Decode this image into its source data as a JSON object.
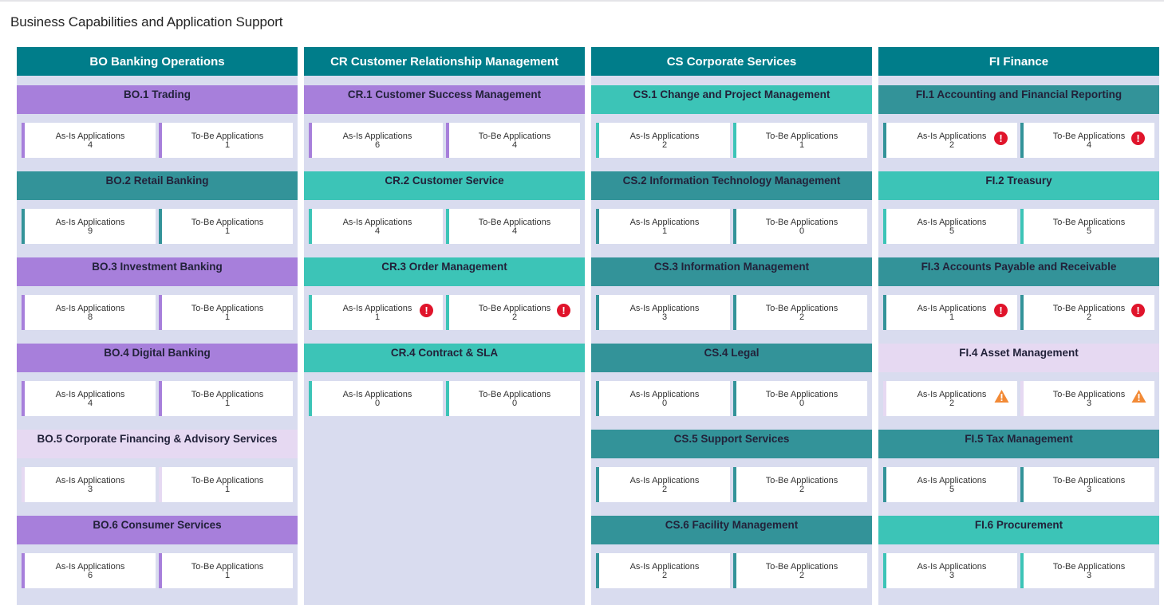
{
  "page_title": "Business Capabilities and Application Support",
  "colors": {
    "header": "#007d8a",
    "purple": "#a77fdb",
    "teal_dark": "#339399",
    "teal_light": "#3cc4b7",
    "lavender": "#e6d9f2",
    "column_bg": "#d9dcef",
    "error": "#e0142b",
    "warning": "#f28a36"
  },
  "columns": [
    {
      "title": "BO Banking Operations",
      "capabilities": [
        {
          "title": "BO.1 Trading",
          "color": "purple",
          "as_is_label": "As-Is Applications",
          "as_is": "4",
          "to_be_label": "To-Be Applications",
          "to_be": "1",
          "as_is_flag": "",
          "to_be_flag": ""
        },
        {
          "title": "BO.2 Retail Banking",
          "color": "teal_dark",
          "as_is_label": "As-Is Applications",
          "as_is": "9",
          "to_be_label": "To-Be Applications",
          "to_be": "1",
          "as_is_flag": "",
          "to_be_flag": ""
        },
        {
          "title": "BO.3 Investment Banking",
          "color": "purple",
          "as_is_label": "As-Is Applications",
          "as_is": "8",
          "to_be_label": "To-Be Applications",
          "to_be": "1",
          "as_is_flag": "",
          "to_be_flag": ""
        },
        {
          "title": "BO.4 Digital Banking",
          "color": "purple",
          "as_is_label": "As-Is Applications",
          "as_is": "4",
          "to_be_label": "To-Be Applications",
          "to_be": "1",
          "as_is_flag": "",
          "to_be_flag": ""
        },
        {
          "title": "BO.5 Corporate Financing & Advisory Services",
          "color": "lavender",
          "as_is_label": "As-Is Applications",
          "as_is": "3",
          "to_be_label": "To-Be Applications",
          "to_be": "1",
          "as_is_flag": "",
          "to_be_flag": ""
        },
        {
          "title": "BO.6 Consumer Services",
          "color": "purple",
          "as_is_label": "As-Is Applications",
          "as_is": "6",
          "to_be_label": "To-Be Applications",
          "to_be": "1",
          "as_is_flag": "",
          "to_be_flag": ""
        }
      ]
    },
    {
      "title": "CR Customer Relationship Management",
      "capabilities": [
        {
          "title": "CR.1 Customer Success Management",
          "color": "purple",
          "as_is_label": "As-Is Applications",
          "as_is": "6",
          "to_be_label": "To-Be Applications",
          "to_be": "4",
          "as_is_flag": "",
          "to_be_flag": ""
        },
        {
          "title": "CR.2 Customer Service",
          "color": "teal_light",
          "as_is_label": "As-Is Applications",
          "as_is": "4",
          "to_be_label": "To-Be Applications",
          "to_be": "4",
          "as_is_flag": "",
          "to_be_flag": ""
        },
        {
          "title": "CR.3 Order Management",
          "color": "teal_light",
          "as_is_label": "As-Is Applications",
          "as_is": "1",
          "to_be_label": "To-Be Applications",
          "to_be": "2",
          "as_is_flag": "error",
          "to_be_flag": "error"
        },
        {
          "title": "CR.4 Contract & SLA",
          "color": "teal_light",
          "as_is_label": "As-Is Applications",
          "as_is": "0",
          "to_be_label": "To-Be Applications",
          "to_be": "0",
          "as_is_flag": "",
          "to_be_flag": ""
        }
      ]
    },
    {
      "title": "CS Corporate Services",
      "capabilities": [
        {
          "title": "CS.1 Change and Project Management",
          "color": "teal_light",
          "as_is_label": "As-Is Applications",
          "as_is": "2",
          "to_be_label": "To-Be Applications",
          "to_be": "1",
          "as_is_flag": "",
          "to_be_flag": ""
        },
        {
          "title": "CS.2 Information Technology Management",
          "color": "teal_dark",
          "as_is_label": "As-Is Applications",
          "as_is": "1",
          "to_be_label": "To-Be Applications",
          "to_be": "0",
          "as_is_flag": "",
          "to_be_flag": ""
        },
        {
          "title": "CS.3 Information Management",
          "color": "teal_dark",
          "as_is_label": "As-Is Applications",
          "as_is": "3",
          "to_be_label": "To-Be Applications",
          "to_be": "2",
          "as_is_flag": "",
          "to_be_flag": ""
        },
        {
          "title": "CS.4 Legal",
          "color": "teal_dark",
          "as_is_label": "As-Is Applications",
          "as_is": "0",
          "to_be_label": "To-Be Applications",
          "to_be": "0",
          "as_is_flag": "",
          "to_be_flag": ""
        },
        {
          "title": "CS.5 Support Services",
          "color": "teal_dark",
          "as_is_label": "As-Is Applications",
          "as_is": "2",
          "to_be_label": "To-Be Applications",
          "to_be": "2",
          "as_is_flag": "",
          "to_be_flag": ""
        },
        {
          "title": "CS.6 Facility Management",
          "color": "teal_dark",
          "as_is_label": "As-Is Applications",
          "as_is": "2",
          "to_be_label": "To-Be Applications",
          "to_be": "2",
          "as_is_flag": "",
          "to_be_flag": ""
        }
      ]
    },
    {
      "title": "FI Finance",
      "capabilities": [
        {
          "title": "FI.1 Accounting and Financial Reporting",
          "color": "teal_dark",
          "as_is_label": "As-Is Applications",
          "as_is": "2",
          "to_be_label": "To-Be Applications",
          "to_be": "4",
          "as_is_flag": "error",
          "to_be_flag": "error"
        },
        {
          "title": "FI.2 Treasury",
          "color": "teal_light",
          "as_is_label": "As-Is Applications",
          "as_is": "5",
          "to_be_label": "To-Be Applications",
          "to_be": "5",
          "as_is_flag": "",
          "to_be_flag": ""
        },
        {
          "title": "FI.3 Accounts Payable and Receivable",
          "color": "teal_dark",
          "as_is_label": "As-Is Applications",
          "as_is": "1",
          "to_be_label": "To-Be Applications",
          "to_be": "2",
          "as_is_flag": "error",
          "to_be_flag": "error"
        },
        {
          "title": "FI.4 Asset Management",
          "color": "lavender",
          "as_is_label": "As-Is Applications",
          "as_is": "2",
          "to_be_label": "To-Be Applications",
          "to_be": "3",
          "as_is_flag": "warning",
          "to_be_flag": "warning"
        },
        {
          "title": "FI.5 Tax Management",
          "color": "teal_dark",
          "as_is_label": "As-Is Applications",
          "as_is": "5",
          "to_be_label": "To-Be Applications",
          "to_be": "3",
          "as_is_flag": "",
          "to_be_flag": ""
        },
        {
          "title": "FI.6 Procurement",
          "color": "teal_light",
          "as_is_label": "As-Is Applications",
          "as_is": "3",
          "to_be_label": "To-Be Applications",
          "to_be": "3",
          "as_is_flag": "",
          "to_be_flag": ""
        }
      ]
    }
  ]
}
